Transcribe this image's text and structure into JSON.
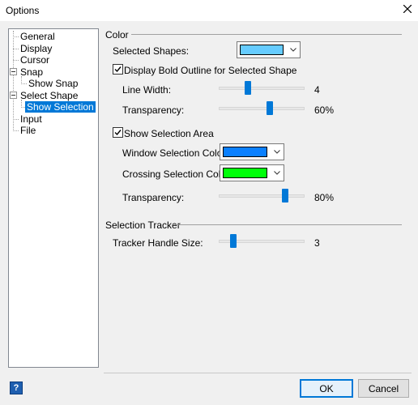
{
  "window": {
    "title": "Options"
  },
  "tree": {
    "items": [
      {
        "label": "General"
      },
      {
        "label": "Display"
      },
      {
        "label": "Cursor"
      },
      {
        "label": "Snap"
      },
      {
        "label": "Show Snap"
      },
      {
        "label": "Select Shape"
      },
      {
        "label": "Show Selection"
      },
      {
        "label": "Input"
      },
      {
        "label": "File"
      }
    ],
    "selected": "Show Selection"
  },
  "color_section": {
    "title": "Color",
    "selected_shapes_label": "Selected Shapes:",
    "selected_shapes_color": "#66ccff",
    "bold_outline": {
      "label": "Display Bold Outline for Selected Shape",
      "checked": true
    },
    "line_width": {
      "label": "Line Width:",
      "value": "4",
      "fraction": 0.33
    },
    "outline_transparency": {
      "label": "Transparency:",
      "value": "60%",
      "fraction": 0.6
    },
    "show_selection_area": {
      "label": "Show Selection Area",
      "checked": true
    },
    "window_selection": {
      "label": "Window Selection Color:",
      "color": "#0a80ff"
    },
    "crossing_selection": {
      "label": "Crossing Selection Color:",
      "color": "#00ff0a"
    },
    "area_transparency": {
      "label": "Transparency:",
      "value": "80%",
      "fraction": 0.8
    }
  },
  "tracker_section": {
    "title": "Selection Tracker",
    "handle_size": {
      "label": "Tracker Handle Size:",
      "value": "3",
      "fraction": 0.14
    }
  },
  "buttons": {
    "ok": "OK",
    "cancel": "Cancel"
  },
  "colors": {
    "accent": "#0078d7"
  }
}
